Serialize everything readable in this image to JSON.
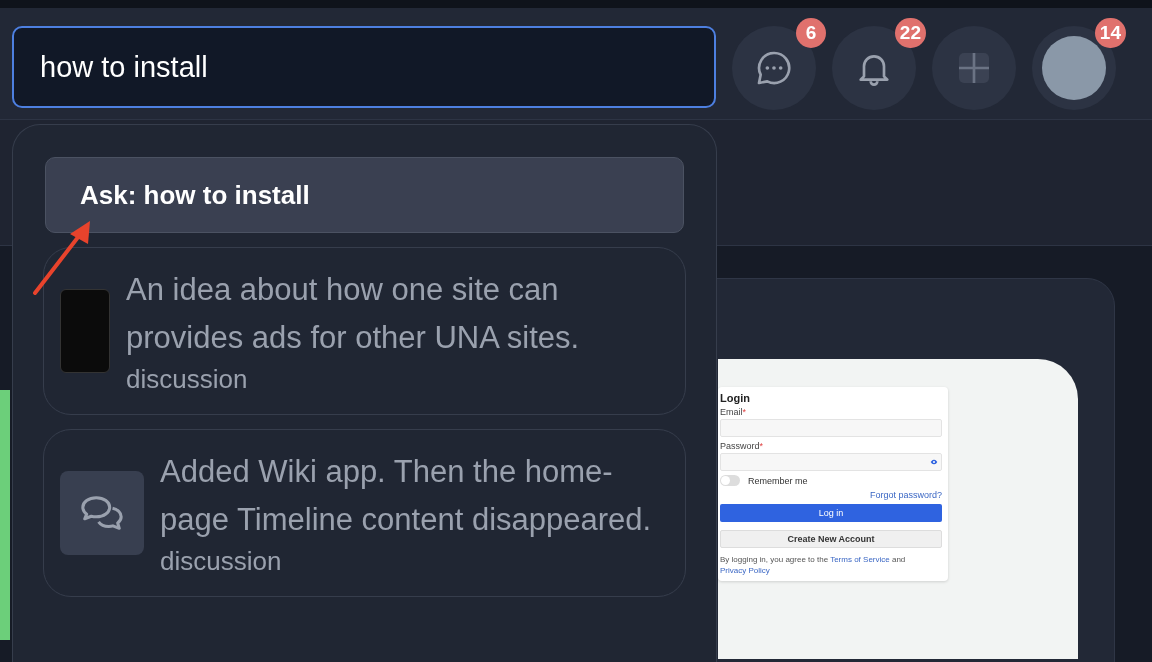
{
  "search": {
    "value": "how to install"
  },
  "header_actions": [
    {
      "kind": "messages",
      "badge": "6"
    },
    {
      "kind": "notifications",
      "badge": "22"
    },
    {
      "kind": "add"
    },
    {
      "kind": "avatar",
      "badge": "14"
    }
  ],
  "suggestions": [
    {
      "kind": "ask",
      "label": "Ask: how to install",
      "selected": true
    },
    {
      "kind": "image",
      "title": "An idea about how one site can provides ads for other UNA sites.",
      "type": "discussion",
      "selected": false
    },
    {
      "kind": "icon",
      "title": "Added Wiki app. Then the home-page Timeline content disappeared.",
      "type": "discussion",
      "selected": false
    }
  ],
  "preview": {
    "title": "Login",
    "fields": [
      {
        "label": "Email",
        "required_mark": "*",
        "kind": "text"
      },
      {
        "label": "Password",
        "required_mark": "*",
        "kind": "password"
      }
    ],
    "remember": {
      "label": "Remember me",
      "on": false
    },
    "forgot": "Forgot password?",
    "login_button": "Log in",
    "create_button": "Create New Account",
    "terms": {
      "before": "By logging in, you agree to the ",
      "terms_link": "Terms of Service",
      "middle": " and ",
      "privacy_link": "Privacy Policy"
    }
  }
}
